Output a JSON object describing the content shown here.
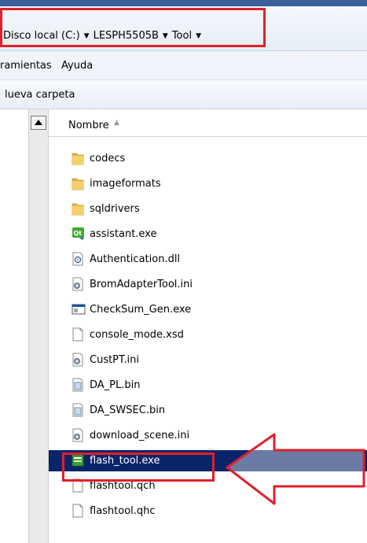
{
  "address": {
    "crumbs": [
      "Disco local (C:)",
      "LESPH5505B",
      "Tool"
    ]
  },
  "menu": {
    "items": [
      "ramientas",
      "Ayuda"
    ]
  },
  "toolbar": {
    "new_folder": "lueva carpeta"
  },
  "list": {
    "header": "Nombre",
    "files": [
      {
        "name": "codecs",
        "icon": "folder-icon"
      },
      {
        "name": "imageformats",
        "icon": "folder-icon"
      },
      {
        "name": "sqldrivers",
        "icon": "folder-icon"
      },
      {
        "name": "assistant.exe",
        "icon": "qt-app-icon"
      },
      {
        "name": "Authentication.dll",
        "icon": "dll-icon"
      },
      {
        "name": "BromAdapterTool.ini",
        "icon": "ini-icon"
      },
      {
        "name": "CheckSum_Gen.exe",
        "icon": "exe-window-icon"
      },
      {
        "name": "console_mode.xsd",
        "icon": "blank-file-icon"
      },
      {
        "name": "CustPT.ini",
        "icon": "ini-icon"
      },
      {
        "name": "DA_PL.bin",
        "icon": "bin-icon"
      },
      {
        "name": "DA_SWSEC.bin",
        "icon": "bin-icon"
      },
      {
        "name": "download_scene.ini",
        "icon": "ini-icon"
      },
      {
        "name": "flash_tool.exe",
        "icon": "flash-tool-icon",
        "selected": true
      },
      {
        "name": "flashtool.qch",
        "icon": "blank-file-icon"
      },
      {
        "name": "flashtool.qhc",
        "icon": "blank-file-icon"
      }
    ]
  },
  "colors": {
    "highlight": "#e0202a",
    "selection": "#0a246a"
  }
}
